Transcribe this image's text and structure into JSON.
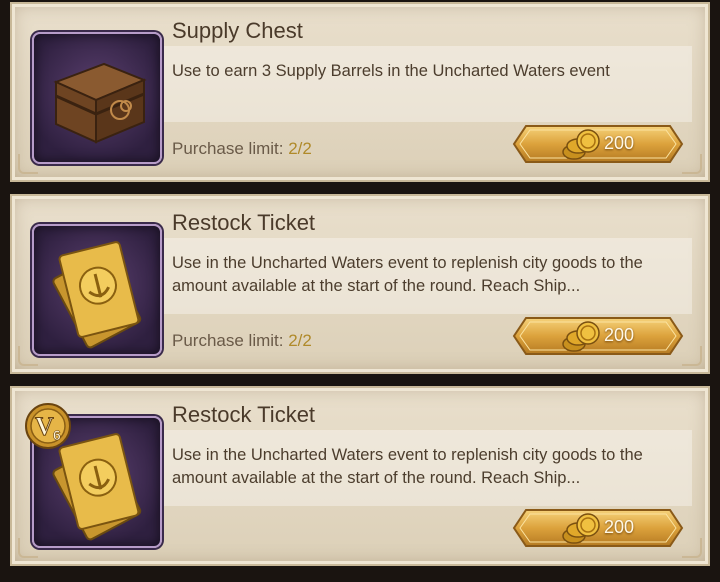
{
  "items": [
    {
      "title": "Supply Chest",
      "description": "Use to earn 3 Supply Barrels in the Uncharted Waters event",
      "limit_label": "Purchase limit:",
      "limit_value": "2/2",
      "price": "200",
      "icon": "chest-icon"
    },
    {
      "title": "Restock Ticket",
      "description": "Use in the Uncharted Waters event to replenish city goods to the amount available at the start of the round. Reach Ship...",
      "limit_label": "Purchase limit:",
      "limit_value": "2/2",
      "price": "200",
      "icon": "ticket-icon"
    },
    {
      "title": "Restock Ticket",
      "description": "Use in the Uncharted Waters event to replenish city goods to the amount available at the start of the round. Reach Ship...",
      "price": "200",
      "icon": "ticket-icon",
      "vip_badge": "6"
    }
  ],
  "colors": {
    "card_bg": "#e3d8c2",
    "icon_bg": "#3d2a52",
    "limit_value": "#b08a2a",
    "button_gold": "#d9a33a"
  }
}
